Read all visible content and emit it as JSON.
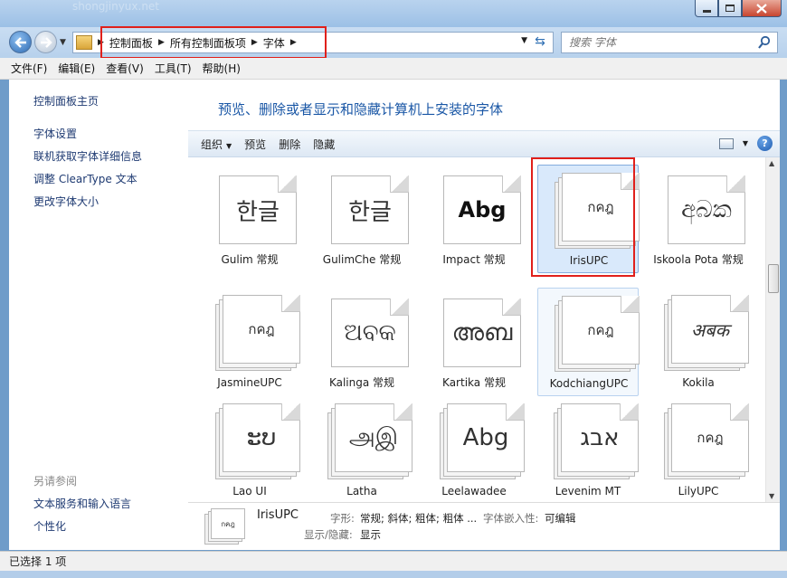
{
  "window": {
    "ghost_title": "shongjinyux.net",
    "minimize_label": "–",
    "maximize_label": "□",
    "close_label": "✕"
  },
  "address": {
    "breadcrumbs": [
      "控制面板",
      "所有控制面板项",
      "字体"
    ],
    "search_placeholder": "搜索 字体"
  },
  "menubar": [
    "文件(F)",
    "编辑(E)",
    "查看(V)",
    "工具(T)",
    "帮助(H)"
  ],
  "sidebar": {
    "home": "控制面板主页",
    "links": [
      "字体设置",
      "联机获取字体详细信息",
      "调整 ClearType 文本",
      "更改字体大小"
    ],
    "see_also_header": "另请参阅",
    "see_also": [
      "文本服务和输入语言",
      "个性化"
    ]
  },
  "main": {
    "heading": "预览、删除或者显示和隐藏计算机上安装的字体",
    "toolbar": {
      "organize": "组织",
      "preview": "预览",
      "delete": "删除",
      "hide": "隐藏"
    }
  },
  "fonts": [
    {
      "name": "Gulim 常规",
      "glyph": "한글",
      "stack": false
    },
    {
      "name": "GulimChe 常规",
      "glyph": "한글",
      "stack": false
    },
    {
      "name": "Impact 常规",
      "glyph": "Abg",
      "stack": false
    },
    {
      "name": "IrisUPC",
      "glyph": "กคฎ",
      "stack": true,
      "selected": true
    },
    {
      "name": "Iskoola Pota 常规",
      "glyph": "අබක",
      "stack": false
    },
    {
      "name": "JasmineUPC",
      "glyph": "กคฎ",
      "stack": true
    },
    {
      "name": "Kalinga 常规",
      "glyph": "ଅବକ",
      "stack": false
    },
    {
      "name": "Kartika 常规",
      "glyph": "അബ",
      "stack": false
    },
    {
      "name": "KodchiangUPC",
      "glyph": "กคฎ",
      "stack": true,
      "hovered": true
    },
    {
      "name": "Kokila",
      "glyph": "अबक",
      "stack": true
    },
    {
      "name": "Lao UI",
      "glyph": "ະບ",
      "stack": true
    },
    {
      "name": "Latha",
      "glyph": "அஇ",
      "stack": true
    },
    {
      "name": "Leelawadee",
      "glyph": "Abg",
      "stack": true
    },
    {
      "name": "Levenim MT",
      "glyph": "אבג",
      "stack": true
    },
    {
      "name": "LilyUPC",
      "glyph": "กคฎ",
      "stack": true
    }
  ],
  "details": {
    "name": "IrisUPC",
    "style_label": "字形:",
    "style_value": "常规; 斜体; 粗体; 粗体 ...",
    "embed_label": "字体嵌入性:",
    "embed_value": "可编辑",
    "visibility_label": "显示/隐藏:",
    "visibility_value": "显示",
    "preview_glyph": "กคฎ"
  },
  "status": {
    "text": "已选择 1 项"
  }
}
